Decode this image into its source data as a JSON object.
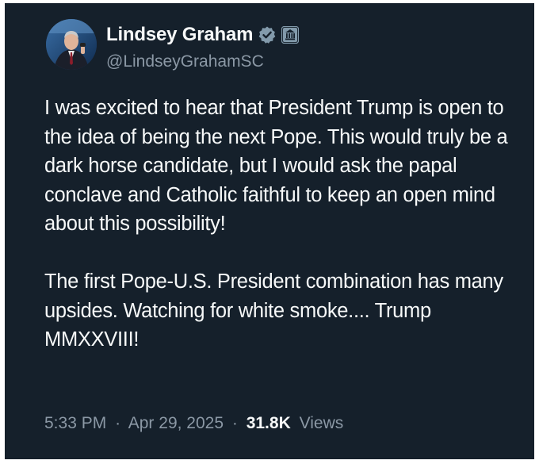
{
  "author": {
    "display_name": "Lindsey Graham",
    "handle": "@LindseyGrahamSC",
    "avatar_icon": "profile-photo",
    "verified_icon": "verified-badge-icon",
    "affiliation_icon": "government-building-icon"
  },
  "tweet": {
    "paragraph_1": "I was excited to hear that President Trump is open to the idea of being the next Pope. This would truly be a dark horse candidate, but I would ask the papal conclave and Catholic faithful to keep an open mind about this possibility!",
    "paragraph_2": "The first Pope-U.S. President combination has many upsides. Watching for white smoke.... Trump MMXXVIII!"
  },
  "meta": {
    "time": "5:33 PM",
    "separator": "·",
    "date": "Apr 29, 2025",
    "views_count": "31.8K",
    "views_label": "Views"
  },
  "colors": {
    "background": "#15202b",
    "primary_text": "#f7f9f9",
    "secondary_text": "#8b98a5",
    "verified_badge": "#829aab",
    "gov_badge": "#829aab"
  }
}
